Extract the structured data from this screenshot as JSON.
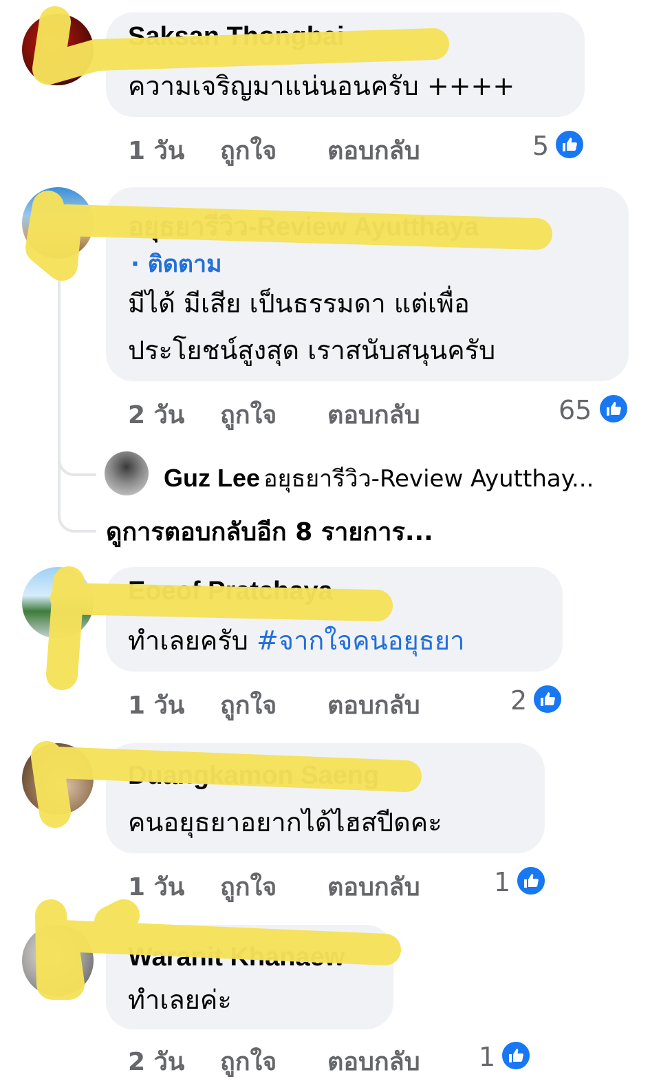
{
  "comments": [
    {
      "author": "Saksan Thongbai",
      "text_lines": [
        "ความเจริญมาแน่นอนครับ ++++"
      ],
      "time": "1 วัน",
      "like": "ถูกใจ",
      "reply": "ตอบกลับ",
      "reactions": "5"
    },
    {
      "author": "อยุธยารีวิว-Review Ayutthaya",
      "follow": "· ติดตาม",
      "text_lines": [
        "มีได้ มีเสีย เป็นธรรมดา แต่เพื่อ",
        "ประโยชน์สูงสุด เราสนับสนุนครับ"
      ],
      "time": "2 วัน",
      "like": "ถูกใจ",
      "reply": "ตอบกลับ",
      "reactions": "65",
      "reply_preview": {
        "name": "Guz Lee",
        "snippet": "อยุธยารีวิว-Review Ayutthay..."
      },
      "more_replies": "ดูการตอบกลับอีก 8 รายการ..."
    },
    {
      "author": "Eoeof Pratchaya",
      "text_plain": "ทำเลยครับ ",
      "hashtag": "#จากใจคนอยุธยา",
      "time": "1 วัน",
      "like": "ถูกใจ",
      "reply": "ตอบกลับ",
      "reactions": "2"
    },
    {
      "author": "Duangkamon Saeng",
      "text_lines": [
        "คนอยุธยาอยากได้ไฮสปีดคะ"
      ],
      "time": "1 วัน",
      "like": "ถูกใจ",
      "reply": "ตอบกลับ",
      "reactions": "1"
    },
    {
      "author": "Waranit Khanaew",
      "text_lines": [
        "ทำเลยค่ะ"
      ],
      "time": "2 วัน",
      "like": "ถูกใจ",
      "reply": "ตอบกลับ",
      "reactions": "1"
    }
  ],
  "colors": {
    "bubble": "#f0f2f5",
    "link": "#216fdb",
    "like_icon": "#1877f2",
    "redaction": "#f5e15a",
    "meta_text": "#65676b"
  },
  "icons": {
    "reaction": "thumbs-up-icon"
  }
}
